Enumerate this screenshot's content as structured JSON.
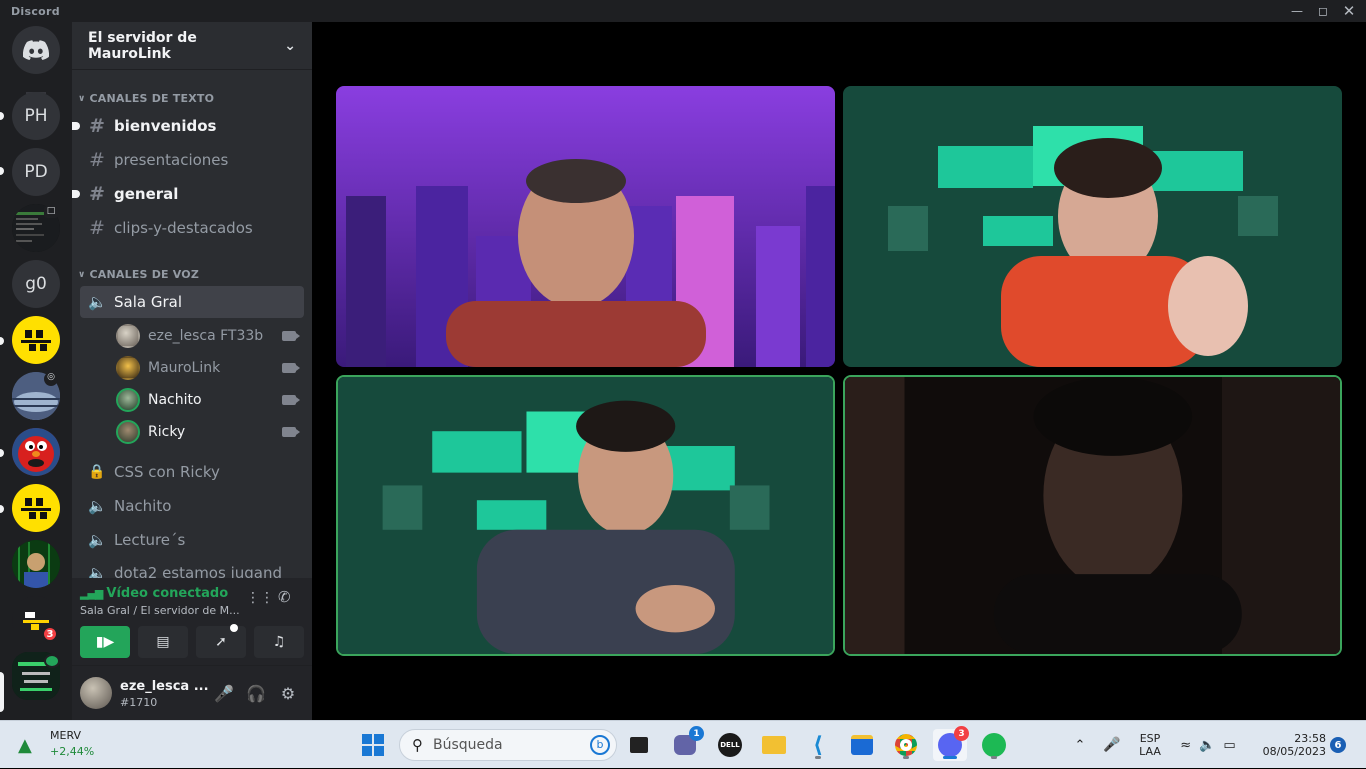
{
  "window": {
    "app_name": "Discord",
    "controls": [
      "minimize",
      "maximize",
      "close"
    ]
  },
  "rail": {
    "home_icon": "discord-logo-icon",
    "servers": [
      {
        "label": "PH",
        "unread": true
      },
      {
        "label": "PD",
        "unread": true
      },
      {
        "label": "",
        "icon": "screenshot-server-icon"
      },
      {
        "label": "g0",
        "unread": false
      },
      {
        "label": "",
        "icon": "yellow-logo-icon",
        "unread": true
      },
      {
        "label": "",
        "icon": "steam-community-icon"
      },
      {
        "label": "",
        "icon": "elmo-icon",
        "unread": true
      },
      {
        "label": "",
        "icon": "yellow-logo-icon",
        "unread": true
      },
      {
        "label": "",
        "icon": "matrix-avatar-icon"
      },
      {
        "label": "",
        "icon": "black-yellow-logo-icon",
        "badge": "3"
      },
      {
        "label": "",
        "icon": "event-poster-icon"
      }
    ]
  },
  "sidebar": {
    "server_name": "El servidor de MauroLink",
    "text_category": "CANALES DE TEXTO",
    "text_channels": [
      {
        "name": "bienvenidos",
        "unread": true
      },
      {
        "name": "presentaciones",
        "unread": false
      },
      {
        "name": "general",
        "unread": true
      },
      {
        "name": "clips-y-destacados",
        "unread": false
      }
    ],
    "voice_category": "CANALES DE VOZ",
    "voice_channels": [
      {
        "name": "Sala Gral",
        "active": true
      },
      {
        "name": "CSS con Ricky",
        "locked": true
      },
      {
        "name": "Nachito"
      },
      {
        "name": "Lecture´s"
      },
      {
        "name": "dota2 estamos jugand"
      }
    ],
    "members": [
      {
        "name": "eze_lesca FT33b",
        "speaking": false,
        "bright": false
      },
      {
        "name": "MauroLink",
        "speaking": false,
        "bright": false
      },
      {
        "name": "Nachito",
        "speaking": true,
        "bright": true
      },
      {
        "name": "Ricky",
        "speaking": true,
        "bright": true
      }
    ]
  },
  "voice_panel": {
    "status": "Vídeo conectado",
    "channel": "Sala Gral / El servidor de M...",
    "buttons": [
      "camera",
      "share-screen",
      "activities",
      "soundboard"
    ]
  },
  "user_panel": {
    "username": "eze_lesca ...",
    "tag": "#1710"
  },
  "taskbar": {
    "stock_name": "MERV",
    "stock_change": "+2,44%",
    "search_placeholder": "Búsqueda",
    "teams_badge": "1",
    "discord_badge": "3",
    "lang_1": "ESP",
    "lang_2": "LAA",
    "time": "23:58",
    "date": "08/05/2023",
    "notif_count": "6"
  },
  "colors": {
    "accent_green": "#23a55a",
    "sidebar_bg": "#2b2d31",
    "rail_bg": "#1e1f22"
  }
}
